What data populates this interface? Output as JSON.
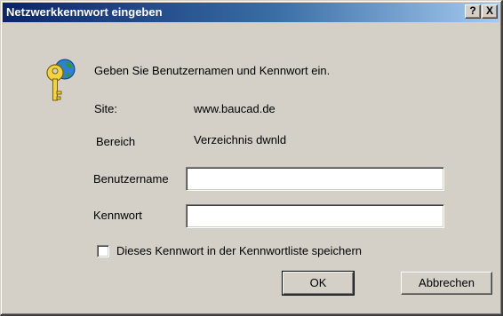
{
  "window": {
    "title": "Netzwerkkennwort eingeben",
    "help_button": "?",
    "close_button": "X"
  },
  "dialog": {
    "prompt": "Geben Sie Benutzernamen und Kennwort ein.",
    "site_label": "Site:",
    "site_value": "www.baucad.de",
    "realm_label": "Bereich",
    "realm_value": "Verzeichnis dwnld",
    "username_label": "Benutzername",
    "username_value": "",
    "password_label": "Kennwort",
    "password_value": "",
    "save_checkbox_label": "Dieses Kennwort in der Kennwortliste speichern",
    "save_checked": false,
    "ok_label": "OK",
    "cancel_label": "Abbrechen"
  },
  "icons": {
    "key": "key-globe-icon"
  }
}
